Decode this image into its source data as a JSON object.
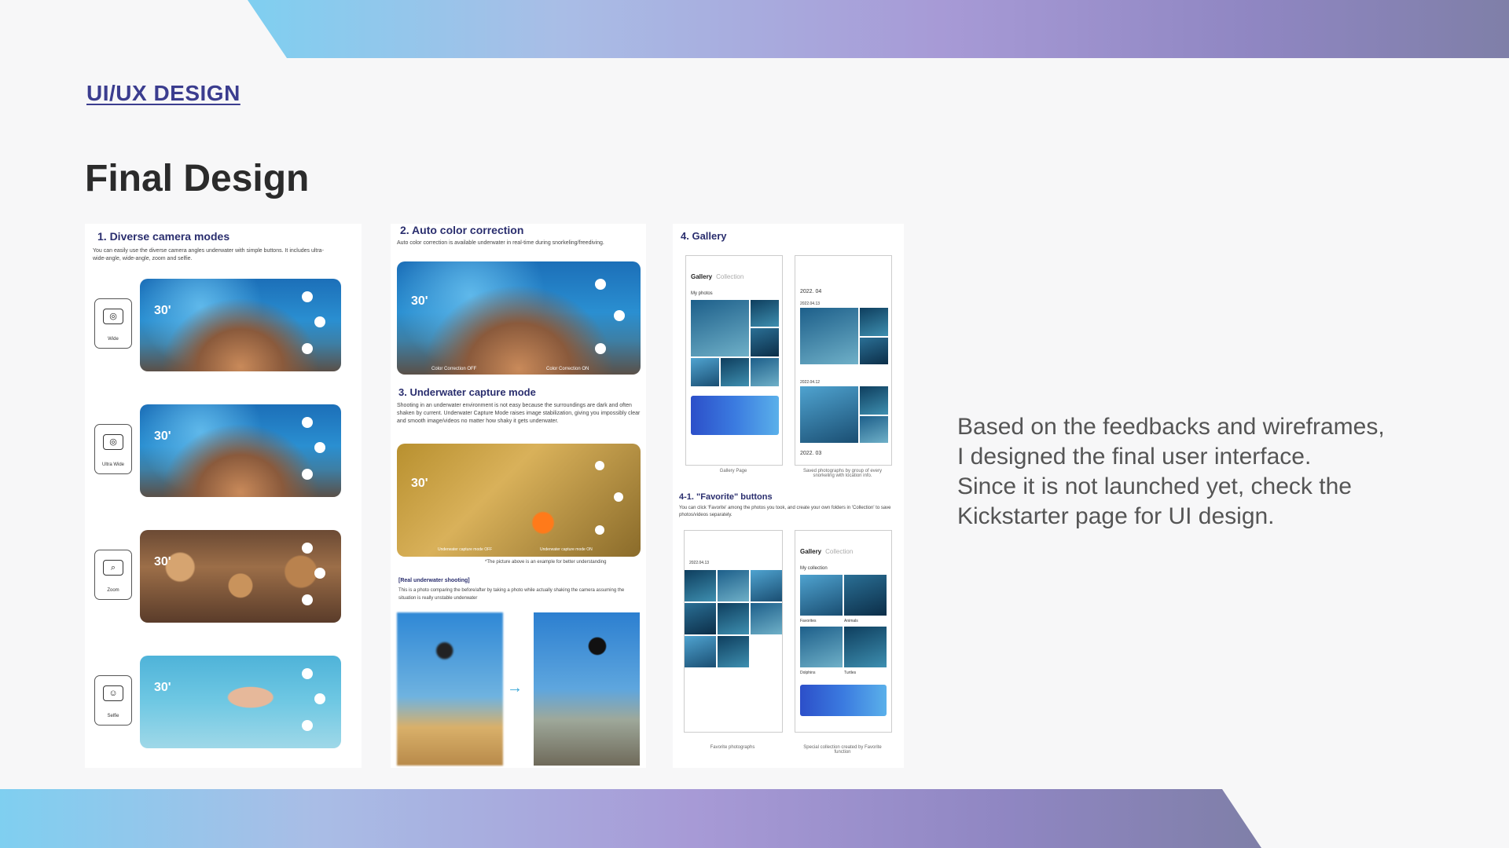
{
  "header": {
    "section_label": "UI/UX DESIGN",
    "title": "Final Design"
  },
  "description": [
    "Based on the feedbacks and wireframes,",
    "I designed the final user interface.",
    "Since it is not launched yet, check the",
    "Kickstarter page for UI design."
  ],
  "panel1": {
    "title": "1. Diverse camera modes",
    "text": "You can easily use the diverse camera angles underwater with simple buttons. It includes ultra-wide-angle, wide-angle, zoom and selfie.",
    "modes": [
      "Wide",
      "Ultra Wide",
      "Zoom",
      "Selfie"
    ],
    "timer": "30'"
  },
  "panel2": {
    "title": "2. Auto color correction",
    "text": "Auto color correction is available underwater in real-time during snorkeling/freediving.",
    "label_off": "Color Correction OFF",
    "label_on": "Color Correction ON",
    "timer": "30'",
    "section3_title": "3. Underwater capture mode",
    "section3_text": "Shooting in an underwater environment is not easy because the surroundings are dark and often shaken by current. Underwater Capture Mode raises image stabilization, giving you impossibly clear and smooth image/videos no matter how shaky it gets underwater.",
    "capture_off": "Underwater capture mode OFF",
    "capture_on": "Underwater capture mode ON",
    "note": "*The picture above is an example for better understanding",
    "real_title": "[Real underwater shooting]",
    "real_text": "This is a photo comparing the before/after by taking a photo while actually shaking the camera assuming the situation is really unstable underwater"
  },
  "panel3": {
    "title": "4. Gallery",
    "tab_gallery": "Gallery",
    "tab_collection": "Collection",
    "my_photos": "My photos",
    "date_a": "2022. 04",
    "date_b": "2022. 03",
    "date_row1": "2022.04.13",
    "date_row2": "2022.04.12",
    "caption_gallery": "Gallery Page",
    "caption_saved": "Saved photographs by group of every snorkeling with location info.",
    "fav_title": "4-1. \"Favorite\" buttons",
    "fav_text": "You can click 'Favorite' among the photos you took, and create your own folders in 'Collection' to save photos/videos separately.",
    "my_collection": "My collection",
    "cat_favorites": "Favorites",
    "cat_animals": "Animals",
    "cat_dolphins": "Dolphins",
    "cat_turtles": "Turtles",
    "caption_fav": "Favorite photographs",
    "caption_special": "Special collection created by Favorite function"
  }
}
